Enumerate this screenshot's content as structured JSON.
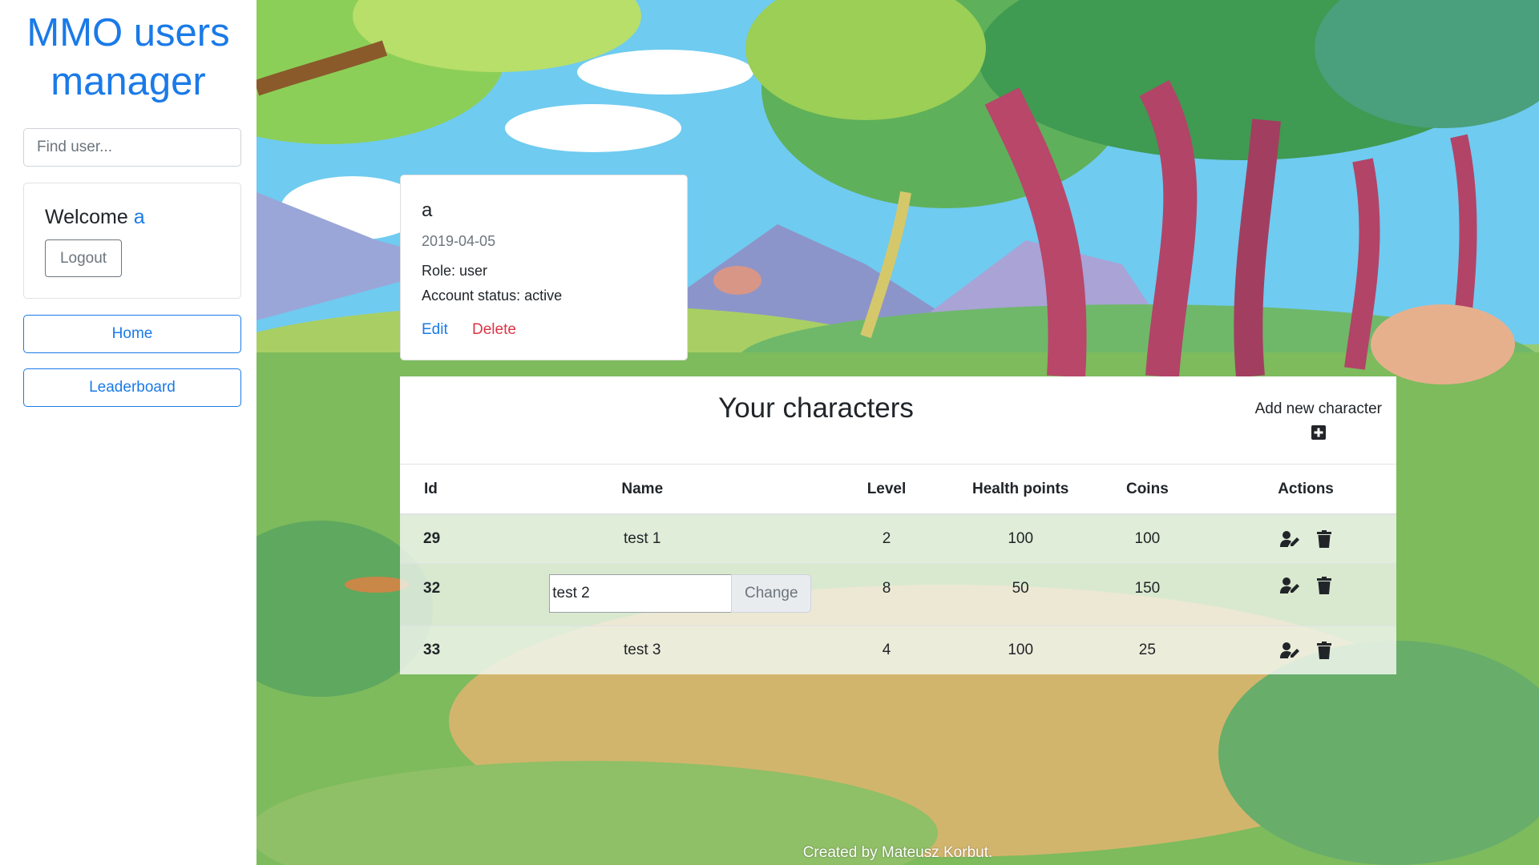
{
  "sidebar": {
    "title_line1": "MMO users",
    "title_line2": "manager",
    "search_placeholder": "Find user...",
    "welcome_prefix": "Welcome ",
    "welcome_user": "a",
    "logout_label": "Logout",
    "nav": [
      {
        "label": "Home"
      },
      {
        "label": "Leaderboard"
      }
    ]
  },
  "user_card": {
    "name": "a",
    "date": "2019-04-05",
    "role": "Role: user",
    "status": "Account status: active",
    "edit_label": "Edit",
    "delete_label": "Delete"
  },
  "characters": {
    "title": "Your characters",
    "add_label": "Add new character",
    "add_icon": "plus-square-icon",
    "columns": [
      "Id",
      "Name",
      "Level",
      "Health points",
      "Coins",
      "Actions"
    ],
    "rows": [
      {
        "id": "29",
        "name": "test 1",
        "level": "2",
        "hp": "100",
        "coins": "100"
      },
      {
        "id": "32",
        "name": "test 2",
        "level": "8",
        "hp": "50",
        "coins": "150",
        "editing": true,
        "change_label": "Change"
      },
      {
        "id": "33",
        "name": "test 3",
        "level": "4",
        "hp": "100",
        "coins": "25"
      }
    ],
    "action_icons": [
      "user-edit-icon",
      "trash-icon"
    ]
  },
  "footer": "Created by Mateusz Korbut.",
  "colors": {
    "primary": "#1a7ae8",
    "danger": "#dc3545",
    "secondary": "#6c757d"
  }
}
